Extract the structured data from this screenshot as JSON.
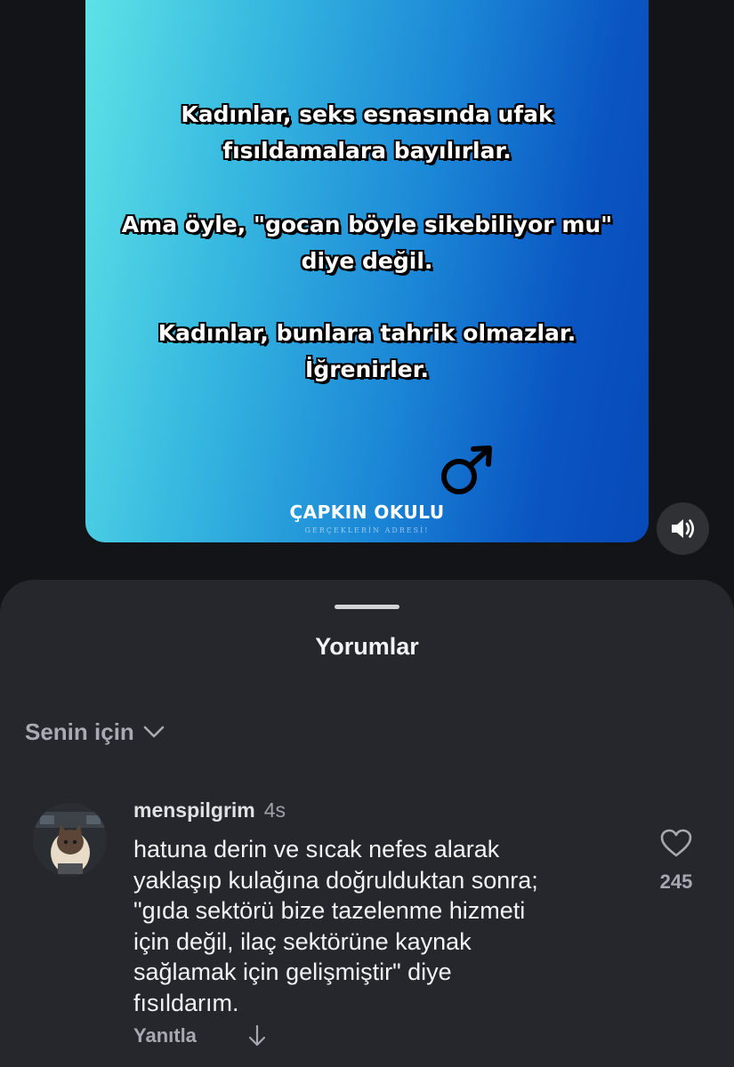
{
  "reel": {
    "text_lines": [
      "Kadınlar, seks esnasında ufak",
      "fısıldamalara bayılırlar.",
      "Ama öyle, \"gocan böyle sikebiliyor mu\"",
      "diye değil.",
      "Kadınlar, bunlara tahrik olmazlar.",
      "İğrenirler."
    ],
    "brand_name": "ÇAPKIN OKULU",
    "brand_tagline": "GERÇEKLERİN ADRESİ!",
    "symbol_icon": "male-symbol-icon",
    "gradient_colors": [
      "#5ee3e6",
      "#0749b8"
    ]
  },
  "controls": {
    "volume_icon": "speaker-icon"
  },
  "comments_sheet": {
    "title": "Yorumlar",
    "filter_label": "Senin için",
    "filter_icon": "chevron-down-icon",
    "comments": [
      {
        "username": "menspilgrim",
        "time": "4s",
        "text_lines": [
          "hatuna derin ve sıcak nefes alarak",
          "yaklaşıp kulağına doğrulduktan sonra;",
          "\"gıda sektörü bize tazelenme hizmeti",
          "için değil, ilaç sektörüne kaynak",
          "sağlamak için gelişmiştir\" diye",
          "fısıldarım."
        ],
        "reply_label": "Yanıtla",
        "like_count": "245",
        "like_icon": "heart-icon",
        "dislike_icon": "arrow-down-icon"
      }
    ]
  },
  "colors": {
    "background": "#121417",
    "sheet": "#25272d",
    "text_primary": "#f1f2f4",
    "text_secondary": "#a6a9af"
  }
}
